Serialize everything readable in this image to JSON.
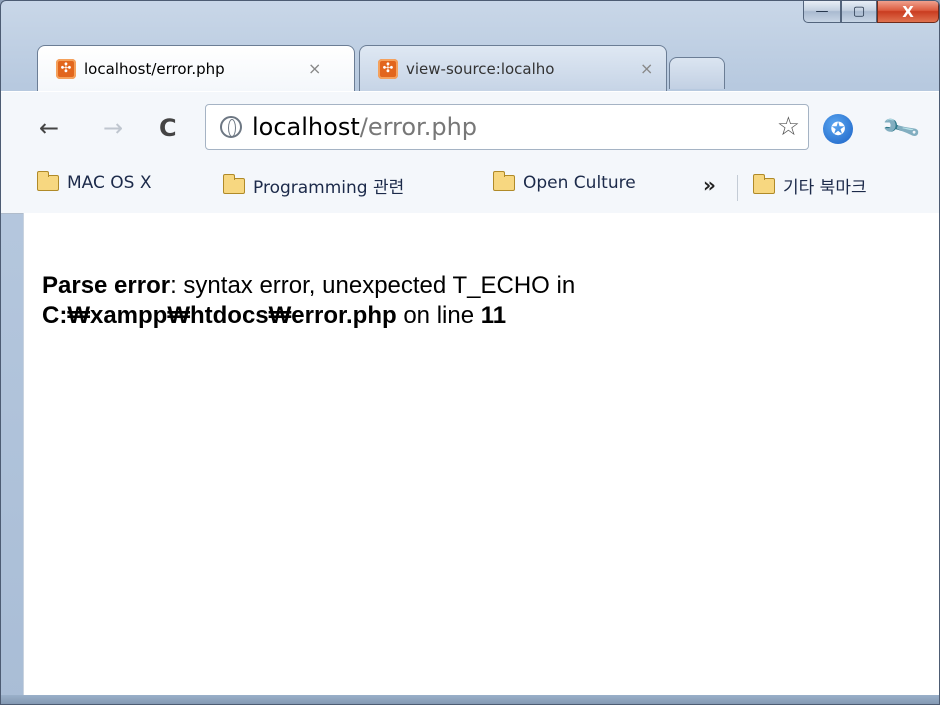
{
  "window": {
    "caption_buttons": {
      "minimize": "—",
      "maximize": "▢",
      "close": "X"
    }
  },
  "tabs": [
    {
      "title": "localhost/error.php",
      "close": "×",
      "active": true
    },
    {
      "title": "view-source:localho",
      "close": "×",
      "active": false
    }
  ],
  "toolbar": {
    "back": "←",
    "forward": "→",
    "reload": "C",
    "url_host": "localhost",
    "url_path": "/error.php",
    "star": "☆",
    "wrench": "🔧"
  },
  "bookmarks": [
    {
      "label": "MAC OS X"
    },
    {
      "label": "Programming 관련"
    },
    {
      "label": "Open Culture"
    }
  ],
  "bookmarks_more": "»",
  "other_bookmarks": "기타 북마크",
  "error": {
    "type": "Parse error",
    "message": ": syntax error, unexpected T_ECHO in",
    "file": "C:₩xampp₩htdocs₩error.php",
    "on_line": " on line ",
    "line": "11"
  }
}
